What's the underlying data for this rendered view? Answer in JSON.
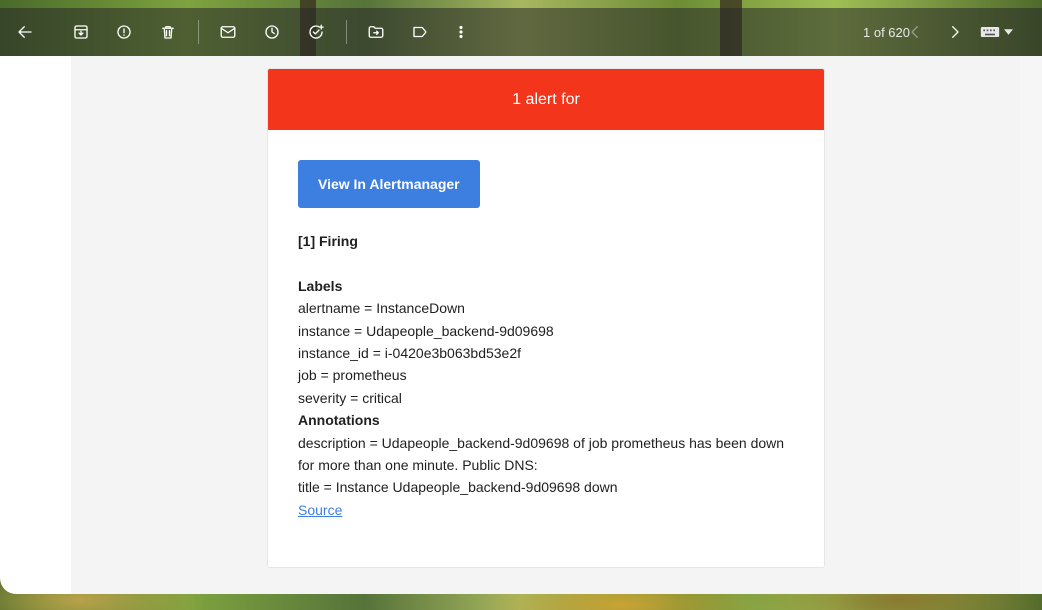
{
  "toolbar": {
    "icons": [
      "back-arrow-icon",
      "archive-icon",
      "report-spam-icon",
      "delete-icon",
      "mark-unread-icon",
      "snooze-icon",
      "add-task-icon",
      "move-to-icon",
      "label-icon",
      "more-vert-icon"
    ],
    "pager": "1 of 620"
  },
  "email": {
    "header": "1 alert for",
    "button_label": "View In Alertmanager",
    "firing": "[1] Firing",
    "labels_title": "Labels",
    "labels": [
      "alertname = InstanceDown",
      "instance = Udapeople_backend-9d09698",
      "instance_id = i-0420e3b063bd53e2f",
      "job = prometheus",
      "severity = critical"
    ],
    "annotations_title": "Annotations",
    "annotations": [
      "description = Udapeople_backend-9d09698 of job prometheus has been down for more than one minute. Public DNS:",
      "title = Instance Udapeople_backend-9d09698 down"
    ],
    "source_link": "Source"
  },
  "colors": {
    "header_red": "#f2351b",
    "button_blue": "#3d7fe0"
  }
}
